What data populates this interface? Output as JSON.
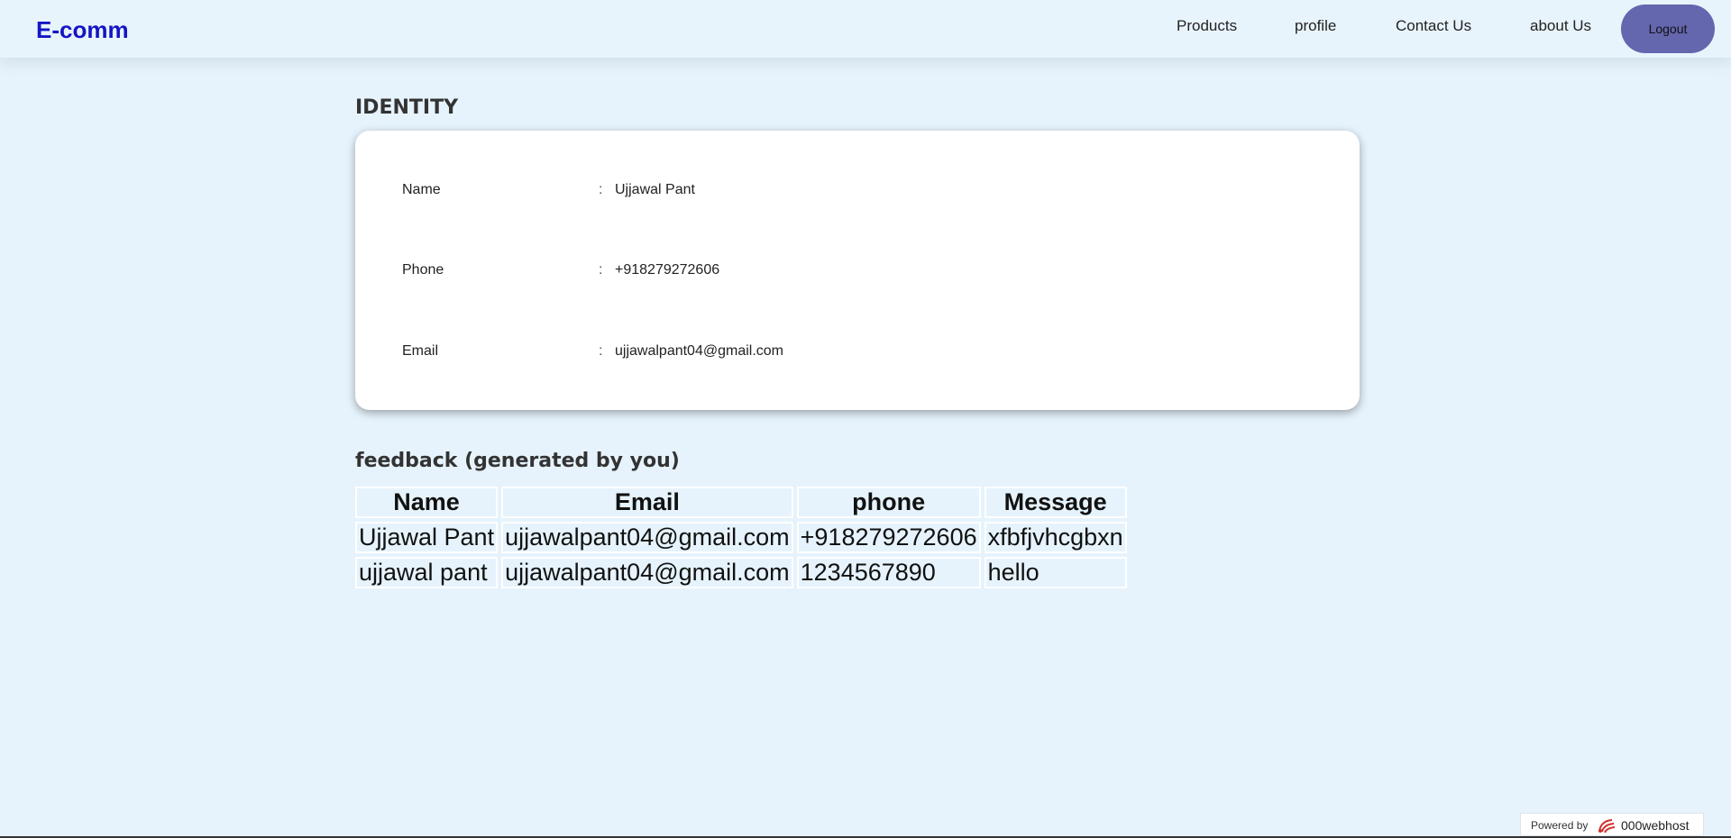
{
  "navbar": {
    "brand": "E-comm",
    "links": [
      {
        "label": "Products"
      },
      {
        "label": "profile"
      },
      {
        "label": "Contact Us"
      },
      {
        "label": "about Us"
      }
    ],
    "logout_label": "Logout"
  },
  "identity": {
    "title": "IDENTITY",
    "rows": [
      {
        "label": "Name",
        "colon": ":",
        "value": "Ujjawal Pant"
      },
      {
        "label": "Phone",
        "colon": ":",
        "value": "+918279272606"
      },
      {
        "label": "Email",
        "colon": ":",
        "value": "ujjawalpant04@gmail.com"
      }
    ]
  },
  "feedback": {
    "title": "feedback (generated by you)",
    "headers": [
      "Name",
      "Email",
      "phone",
      "Message"
    ],
    "rows": [
      [
        "Ujjawal Pant",
        "ujjawalpant04@gmail.com",
        "+918279272606",
        "xfbfjvhcgbxn"
      ],
      [
        "ujjawal pant",
        "ujjawalpant04@gmail.com",
        "1234567890",
        "hello"
      ]
    ]
  },
  "footer_badge": {
    "powered_by": "Powered by",
    "host": "000webhost",
    "logo_icon": "000webhost-logo-icon",
    "accent_color": "#d0312d"
  },
  "colors": {
    "background": "#e6f3fc",
    "brand": "#1515c4",
    "logout_button": "#6466ae"
  }
}
